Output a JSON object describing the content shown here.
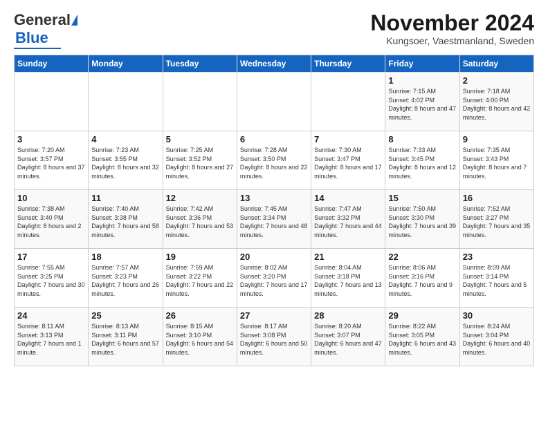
{
  "header": {
    "logo_general": "General",
    "logo_blue": "Blue",
    "title": "November 2024",
    "subtitle": "Kungsoer, Vaestmanland, Sweden"
  },
  "days_of_week": [
    "Sunday",
    "Monday",
    "Tuesday",
    "Wednesday",
    "Thursday",
    "Friday",
    "Saturday"
  ],
  "weeks": [
    [
      {
        "day": "",
        "info": ""
      },
      {
        "day": "",
        "info": ""
      },
      {
        "day": "",
        "info": ""
      },
      {
        "day": "",
        "info": ""
      },
      {
        "day": "",
        "info": ""
      },
      {
        "day": "1",
        "info": "Sunrise: 7:15 AM\nSunset: 4:02 PM\nDaylight: 8 hours and 47 minutes."
      },
      {
        "day": "2",
        "info": "Sunrise: 7:18 AM\nSunset: 4:00 PM\nDaylight: 8 hours and 42 minutes."
      }
    ],
    [
      {
        "day": "3",
        "info": "Sunrise: 7:20 AM\nSunset: 3:57 PM\nDaylight: 8 hours and 37 minutes."
      },
      {
        "day": "4",
        "info": "Sunrise: 7:23 AM\nSunset: 3:55 PM\nDaylight: 8 hours and 32 minutes."
      },
      {
        "day": "5",
        "info": "Sunrise: 7:25 AM\nSunset: 3:52 PM\nDaylight: 8 hours and 27 minutes."
      },
      {
        "day": "6",
        "info": "Sunrise: 7:28 AM\nSunset: 3:50 PM\nDaylight: 8 hours and 22 minutes."
      },
      {
        "day": "7",
        "info": "Sunrise: 7:30 AM\nSunset: 3:47 PM\nDaylight: 8 hours and 17 minutes."
      },
      {
        "day": "8",
        "info": "Sunrise: 7:33 AM\nSunset: 3:45 PM\nDaylight: 8 hours and 12 minutes."
      },
      {
        "day": "9",
        "info": "Sunrise: 7:35 AM\nSunset: 3:43 PM\nDaylight: 8 hours and 7 minutes."
      }
    ],
    [
      {
        "day": "10",
        "info": "Sunrise: 7:38 AM\nSunset: 3:40 PM\nDaylight: 8 hours and 2 minutes."
      },
      {
        "day": "11",
        "info": "Sunrise: 7:40 AM\nSunset: 3:38 PM\nDaylight: 7 hours and 58 minutes."
      },
      {
        "day": "12",
        "info": "Sunrise: 7:42 AM\nSunset: 3:36 PM\nDaylight: 7 hours and 53 minutes."
      },
      {
        "day": "13",
        "info": "Sunrise: 7:45 AM\nSunset: 3:34 PM\nDaylight: 7 hours and 48 minutes."
      },
      {
        "day": "14",
        "info": "Sunrise: 7:47 AM\nSunset: 3:32 PM\nDaylight: 7 hours and 44 minutes."
      },
      {
        "day": "15",
        "info": "Sunrise: 7:50 AM\nSunset: 3:30 PM\nDaylight: 7 hours and 39 minutes."
      },
      {
        "day": "16",
        "info": "Sunrise: 7:52 AM\nSunset: 3:27 PM\nDaylight: 7 hours and 35 minutes."
      }
    ],
    [
      {
        "day": "17",
        "info": "Sunrise: 7:55 AM\nSunset: 3:25 PM\nDaylight: 7 hours and 30 minutes."
      },
      {
        "day": "18",
        "info": "Sunrise: 7:57 AM\nSunset: 3:23 PM\nDaylight: 7 hours and 26 minutes."
      },
      {
        "day": "19",
        "info": "Sunrise: 7:59 AM\nSunset: 3:22 PM\nDaylight: 7 hours and 22 minutes."
      },
      {
        "day": "20",
        "info": "Sunrise: 8:02 AM\nSunset: 3:20 PM\nDaylight: 7 hours and 17 minutes."
      },
      {
        "day": "21",
        "info": "Sunrise: 8:04 AM\nSunset: 3:18 PM\nDaylight: 7 hours and 13 minutes."
      },
      {
        "day": "22",
        "info": "Sunrise: 8:06 AM\nSunset: 3:16 PM\nDaylight: 7 hours and 9 minutes."
      },
      {
        "day": "23",
        "info": "Sunrise: 8:09 AM\nSunset: 3:14 PM\nDaylight: 7 hours and 5 minutes."
      }
    ],
    [
      {
        "day": "24",
        "info": "Sunrise: 8:11 AM\nSunset: 3:13 PM\nDaylight: 7 hours and 1 minute."
      },
      {
        "day": "25",
        "info": "Sunrise: 8:13 AM\nSunset: 3:11 PM\nDaylight: 6 hours and 57 minutes."
      },
      {
        "day": "26",
        "info": "Sunrise: 8:15 AM\nSunset: 3:10 PM\nDaylight: 6 hours and 54 minutes."
      },
      {
        "day": "27",
        "info": "Sunrise: 8:17 AM\nSunset: 3:08 PM\nDaylight: 6 hours and 50 minutes."
      },
      {
        "day": "28",
        "info": "Sunrise: 8:20 AM\nSunset: 3:07 PM\nDaylight: 6 hours and 47 minutes."
      },
      {
        "day": "29",
        "info": "Sunrise: 8:22 AM\nSunset: 3:05 PM\nDaylight: 6 hours and 43 minutes."
      },
      {
        "day": "30",
        "info": "Sunrise: 8:24 AM\nSunset: 3:04 PM\nDaylight: 6 hours and 40 minutes."
      }
    ]
  ]
}
